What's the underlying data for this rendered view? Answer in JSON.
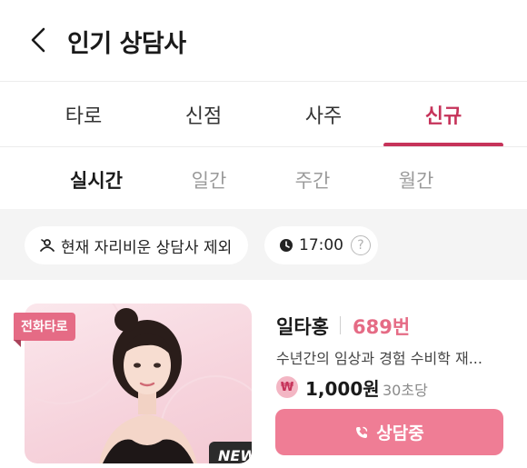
{
  "header": {
    "title": "인기 상담사"
  },
  "tabs": [
    {
      "label": "타로"
    },
    {
      "label": "신점"
    },
    {
      "label": "사주"
    },
    {
      "label": "신규"
    }
  ],
  "active_tab": "신규",
  "periods": [
    {
      "label": "실시간"
    },
    {
      "label": "일간"
    },
    {
      "label": "주간"
    },
    {
      "label": "월간"
    }
  ],
  "active_period": "실시간",
  "filters": {
    "absent_label": "현재 자리비운 상담사 제외",
    "time_label": "17:00",
    "help_glyph": "?"
  },
  "counselor": {
    "type_badge": "전화타로",
    "new_badge": "NEW",
    "name": "일타홍",
    "number": "689번",
    "description": "수년간의 임상과 경험 수비학 재...",
    "currency_symbol": "₩",
    "price": "1,000원",
    "price_unit": "30초당",
    "button_label": "상담중"
  },
  "colors": {
    "accent": "#c6335a",
    "pink": "#e56b85",
    "button": "#ef7d95",
    "filter_bg": "#f4f4f4"
  },
  "icons": {
    "back": "chevron-left-icon",
    "absent": "person-away-icon",
    "clock": "clock-icon",
    "call": "phone-call-icon"
  }
}
